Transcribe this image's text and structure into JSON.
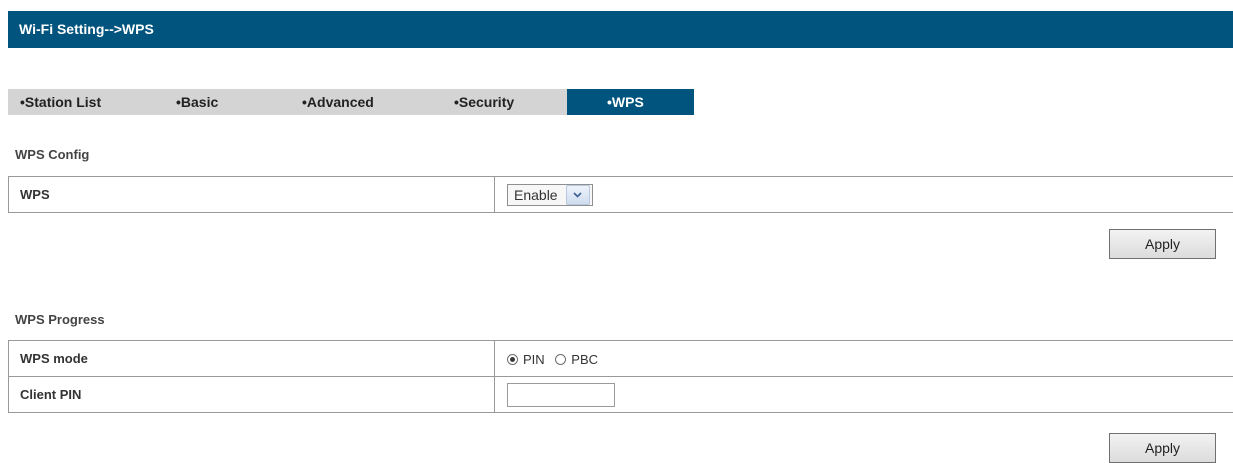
{
  "header": {
    "title": "Wi-Fi Setting-->WPS"
  },
  "tabs": [
    {
      "label": "•Station List",
      "active": false
    },
    {
      "label": "•Basic",
      "active": false
    },
    {
      "label": "•Advanced",
      "active": false
    },
    {
      "label": "•Security",
      "active": false
    },
    {
      "label": "•WPS",
      "active": true
    }
  ],
  "wps_config": {
    "title": "WPS Config",
    "rows": [
      {
        "label": "WPS",
        "select_value": "Enable"
      }
    ],
    "apply_label": "Apply"
  },
  "wps_progress": {
    "title": "WPS Progress",
    "mode_label": "WPS mode",
    "mode_options": [
      {
        "label": "PIN",
        "checked": true
      },
      {
        "label": "PBC",
        "checked": false
      }
    ],
    "client_pin_label": "Client PIN",
    "client_pin_value": "",
    "apply_label": "Apply"
  },
  "colors": {
    "brand": "#00547d",
    "tab_bg": "#d4d4d4"
  },
  "icons": {
    "select_arrow": "chevron-down-icon"
  }
}
